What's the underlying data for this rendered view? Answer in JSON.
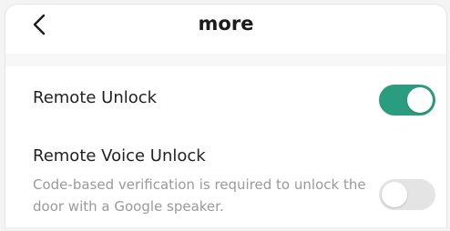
{
  "header": {
    "title": "more",
    "back_icon": "chevron-left-icon"
  },
  "settings": [
    {
      "label": "Remote Unlock",
      "toggle_on": true
    },
    {
      "label": "Remote Voice Unlock",
      "description": "Code-based verification is required to unlock the door with a Google speaker.",
      "toggle_on": false
    }
  ],
  "colors": {
    "toggle_on": "#2a9d7f",
    "toggle_off": "#e4e4e4"
  }
}
